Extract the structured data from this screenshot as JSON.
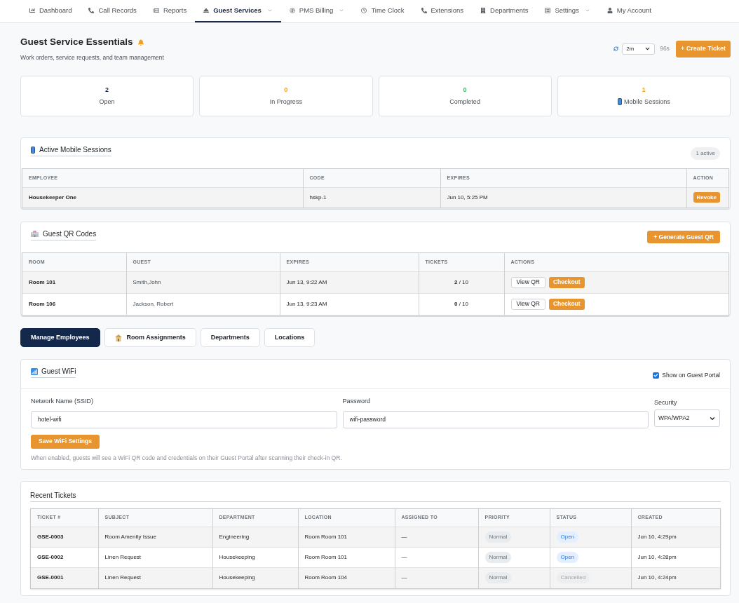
{
  "nav": [
    {
      "label": "Dashboard",
      "has_menu": false,
      "selected": false
    },
    {
      "label": "Call Records",
      "has_menu": false,
      "selected": false
    },
    {
      "label": "Reports",
      "has_menu": false,
      "selected": false
    },
    {
      "label": "Guest Services",
      "has_menu": true,
      "selected": true
    },
    {
      "label": "PMS Billing",
      "has_menu": true,
      "selected": false
    },
    {
      "label": "Time Clock",
      "has_menu": false,
      "selected": false
    },
    {
      "label": "Extensions",
      "has_menu": false,
      "selected": false
    },
    {
      "label": "Departments",
      "has_menu": false,
      "selected": false
    },
    {
      "label": "Settings",
      "has_menu": true,
      "selected": false
    },
    {
      "label": "My Account",
      "has_menu": false,
      "selected": false
    }
  ],
  "header": {
    "title": "Guest Service Essentials",
    "subtitle": "Work orders, service requests, and team management",
    "refresh_interval": "2m",
    "countdown": "96s",
    "create_button": "+ Create Ticket"
  },
  "stats": [
    {
      "value": "2",
      "label": "Open",
      "color": "#1c2a48"
    },
    {
      "value": "0",
      "label": "In Progress",
      "color": "#f0a020"
    },
    {
      "value": "0",
      "label": "Completed",
      "color": "#28c060"
    },
    {
      "value": "1",
      "label": "Mobile Sessions",
      "color": "#f0a020"
    }
  ],
  "active_mobile_sessions": {
    "title": "Active Mobile Sessions",
    "badge": "1 active",
    "columns": [
      "EMPLOYEE",
      "CODE",
      "EXPIRES",
      "ACTION"
    ],
    "rows": [
      {
        "employee": "Housekeeper One",
        "code": "hskp-1",
        "expires": "Jun 10, 5:25 PM",
        "action": "Revoke"
      }
    ]
  },
  "guest_qr_codes": {
    "title": "Guest QR Codes",
    "button": "+ Generate Guest QR",
    "columns": [
      "ROOM",
      "GUEST",
      "EXPIRES",
      "TICKETS",
      "ACTIONS"
    ],
    "rows": [
      {
        "room": "Room 101",
        "guest": "Smith,John",
        "expires": "Jun 13, 9:22 AM",
        "tickets": "**2** / 10",
        "actions": [
          {
            "label": "View QR",
            "kind": "outline"
          },
          {
            "label": "Checkout",
            "kind": "primary"
          }
        ]
      },
      {
        "room": "Room 106",
        "guest": "Jackson, Robert",
        "expires": "Jun 13, 9:23 AM",
        "tickets": "**0** / 10",
        "actions": [
          {
            "label": "View QR",
            "kind": "outline"
          },
          {
            "label": "Checkout",
            "kind": "primary"
          }
        ]
      }
    ]
  },
  "tabs": [
    {
      "label": "Manage Employees",
      "selected": true
    },
    {
      "label": "Room Assignments",
      "selected": false
    },
    {
      "label": "Departments",
      "selected": false
    },
    {
      "label": "Locations",
      "selected": false
    }
  ],
  "guest_wifi": {
    "title": "Guest WiFi",
    "show_on_portal": {
      "label": "Show on Guest Portal",
      "checked": true
    },
    "ssid": {
      "label": "Network Name (SSID)",
      "value": "hotel-wifi"
    },
    "password": {
      "label": "Password",
      "value": "wifi-password"
    },
    "security": {
      "label": "Security",
      "value": "WPA/WPA2"
    },
    "save_button": "Save WiFi Settings",
    "help": "When enabled, guests will see a WiFi QR code and credentials on their Guest Portal after scanning their check-in QR."
  },
  "recent_tickets": {
    "title": "Recent Tickets",
    "columns": [
      "TICKET #",
      "SUBJECT",
      "DEPARTMENT",
      "LOCATION",
      "ASSIGNED TO",
      "PRIORITY",
      "STATUS",
      "CREATED"
    ],
    "rows": [
      {
        "ticket": "GSE-0003",
        "subject": "Room Amenity Issue",
        "department": "Engineering",
        "location": "Room Room 101",
        "assigned_to": "—",
        "priority": "Normal",
        "status": {
          "label": "Open",
          "kind": "open"
        },
        "created": "Jun 10, 4:29pm"
      },
      {
        "ticket": "GSE-0002",
        "subject": "Linen Request",
        "department": "Housekeeping",
        "location": "Room Room 101",
        "assigned_to": "—",
        "priority": "Normal",
        "status": {
          "label": "Open",
          "kind": "open"
        },
        "created": "Jun 10, 4:28pm"
      },
      {
        "ticket": "GSE-0001",
        "subject": "Linen Request",
        "department": "Housekeeping",
        "location": "Room Room 104",
        "assigned_to": "—",
        "priority": "Normal",
        "status": {
          "label": "Cancelled",
          "kind": "cancelled"
        },
        "created": "Jun 10, 4:24pm"
      }
    ]
  }
}
